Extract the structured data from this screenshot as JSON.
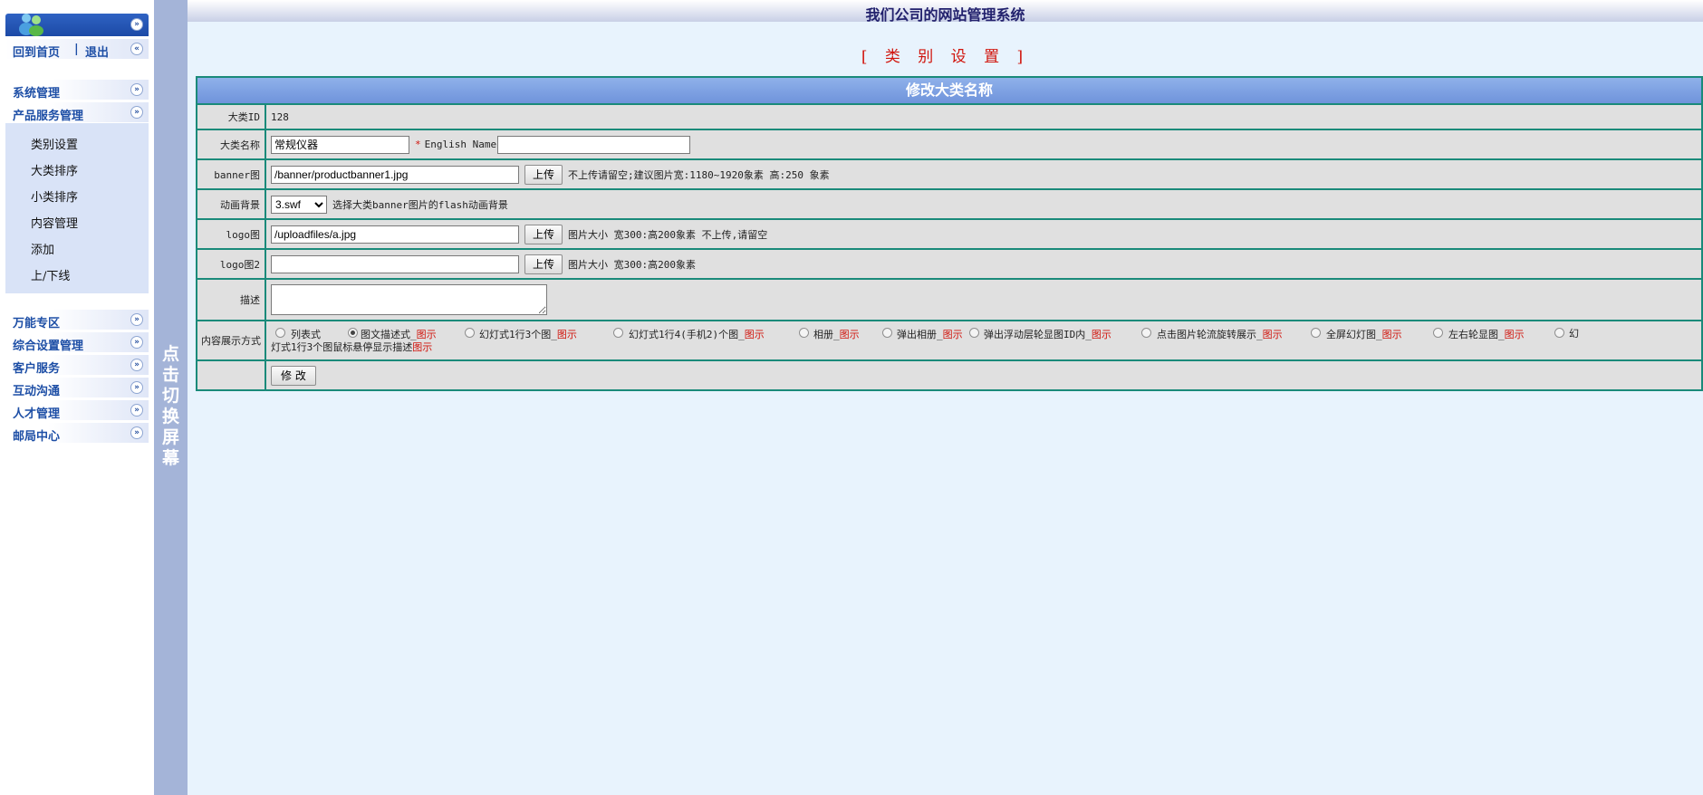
{
  "sidebar": {
    "user_links": {
      "home": "回到首页",
      "separator": "|",
      "logout": "退出"
    },
    "menus_top": [
      {
        "label": "系统管理"
      },
      {
        "label": "产品服务管理"
      }
    ],
    "submenu": [
      "类别设置",
      "大类排序",
      "小类排序",
      "内容管理",
      "添加",
      "上/下线"
    ],
    "menus_bottom": [
      {
        "label": "万能专区"
      },
      {
        "label": "综合设置管理"
      },
      {
        "label": "客户服务"
      },
      {
        "label": "互动沟通"
      },
      {
        "label": "人才管理"
      },
      {
        "label": "邮局中心"
      }
    ]
  },
  "toggle_bar": {
    "text": "点击切换屏幕"
  },
  "header": {
    "title": "我们公司的网站管理系统"
  },
  "page": {
    "heading": "[ 类 别 设 置 ]"
  },
  "form": {
    "title": "修改大类名称",
    "id": {
      "label": "大类ID",
      "value": "128"
    },
    "name": {
      "label": "大类名称",
      "value": "常规仪器",
      "required_mark": "*",
      "english_label": "English Name",
      "english_value": ""
    },
    "banner": {
      "label": "banner图",
      "value": "/banner/productbanner1.jpg",
      "upload_label": "上传",
      "hint": "不上传请留空;建议图片宽:1180~1920象素 高:250 象素"
    },
    "flash": {
      "label": "动画背景",
      "selected": "3.swf",
      "hint": "选择大类banner图片的flash动画背景"
    },
    "logo": {
      "label": "logo图",
      "value": "/uploadfiles/a.jpg",
      "upload_label": "上传",
      "hint": "图片大小 宽300:高200象素 不上传,请留空"
    },
    "logo2": {
      "label": "logo图2",
      "value": "",
      "upload_label": "上传",
      "hint": "图片大小 宽300:高200象素"
    },
    "desc": {
      "label": "描述",
      "value": ""
    },
    "display": {
      "label": "内容展示方式",
      "options": [
        {
          "text": "列表式",
          "demo": "",
          "checked": false
        },
        {
          "text": "图文描述式_",
          "demo": "图示",
          "checked": true
        },
        {
          "text": "幻灯式1行3个图_",
          "demo": "图示",
          "checked": false
        },
        {
          "text": "幻灯式1行4(手机2)个图_",
          "demo": "图示",
          "checked": false
        },
        {
          "text": "相册_",
          "demo": "图示",
          "checked": false
        },
        {
          "text": "弹出相册_",
          "demo": "图示",
          "checked": false
        },
        {
          "text": "弹出浮动层轮显图ID内_",
          "demo": "图示",
          "checked": false
        },
        {
          "text": "点击图片轮流旋转展示_",
          "demo": "图示",
          "checked": false
        },
        {
          "text": "全屏幻灯图_",
          "demo": "图示",
          "checked": false
        },
        {
          "text": "左右轮显图_",
          "demo": "图示",
          "checked": false
        },
        {
          "text": "幻灯式1行3个图鼠标悬停显示描述",
          "demo": "图示",
          "checked": false
        }
      ]
    },
    "submit_label": "修 改"
  },
  "colors": {
    "accent_blue": "#1e4fa6",
    "heading_red": "#d1150d",
    "table_border": "#1a8a7a",
    "page_bg": "#e8f3fd"
  }
}
